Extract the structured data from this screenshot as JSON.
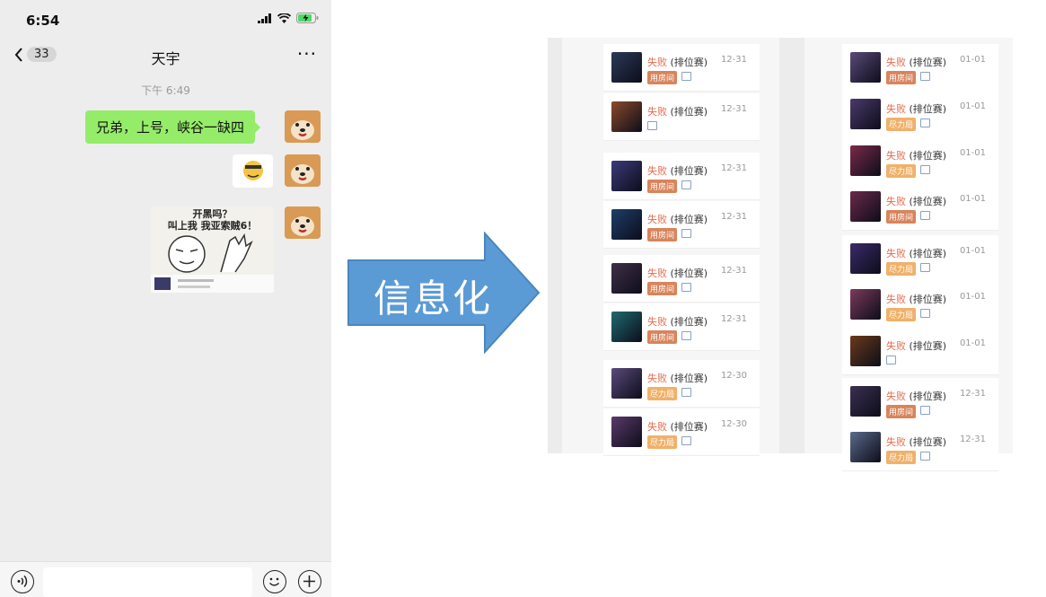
{
  "phone": {
    "status_time": "6:54",
    "back_badge": "33",
    "title": "天宇",
    "more": "···",
    "chat_time": "下午 6:49",
    "message_text": "兄弟，上号，峡谷一缺四",
    "meme_line1": "开黑吗？",
    "meme_line2": "叫上我 我亚索贼6！"
  },
  "arrow_label": "信息化",
  "colors": {
    "bubble": "#95ec69",
    "arrow": "#5b9bd5",
    "loss": "#e36c4e",
    "tag_a": "#d8845c",
    "tag_b": "#f0b169"
  },
  "matches_left": [
    {
      "result": "失败",
      "mode": "(排位赛)",
      "date": "12-31",
      "tag": "用房间",
      "tag_style": "a",
      "champ": "#2b3a58"
    },
    {
      "result": "失败",
      "mode": "(排位赛)",
      "date": "12-31",
      "tag": "",
      "tag_style": "a",
      "champ": "#8a4a2a"
    },
    {
      "result": "失败",
      "mode": "(排位赛)",
      "date": "12-31",
      "tag": "用房间",
      "tag_style": "a",
      "champ": "#3b3a7a"
    },
    {
      "result": "失败",
      "mode": "(排位赛)",
      "date": "12-31",
      "tag": "用房间",
      "tag_style": "a",
      "champ": "#1e3e6a"
    },
    {
      "result": "失败",
      "mode": "(排位赛)",
      "date": "12-31",
      "tag": "用房间",
      "tag_style": "a",
      "champ": "#403048"
    },
    {
      "result": "失败",
      "mode": "(排位赛)",
      "date": "12-31",
      "tag": "用房间",
      "tag_style": "a",
      "champ": "#1f6a70"
    },
    {
      "result": "失败",
      "mode": "(排位赛)",
      "date": "12-30",
      "tag": "尽力局",
      "tag_style": "b",
      "champ": "#5a4a7a"
    },
    {
      "result": "失败",
      "mode": "(排位赛)",
      "date": "12-30",
      "tag": "尽力局",
      "tag_style": "b",
      "champ": "#5a3a6a"
    }
  ],
  "matches_right": [
    {
      "result": "失败",
      "mode": "(排位赛)",
      "date": "01-01",
      "tag": "用房间",
      "tag_style": "a",
      "champ": "#5a4a7a"
    },
    {
      "result": "失败",
      "mode": "(排位赛)",
      "date": "01-01",
      "tag": "尽力局",
      "tag_style": "b",
      "champ": "#4a3a6a"
    },
    {
      "result": "失败",
      "mode": "(排位赛)",
      "date": "01-01",
      "tag": "尽力局",
      "tag_style": "b",
      "champ": "#7a2a4a"
    },
    {
      "result": "失败",
      "mode": "(排位赛)",
      "date": "01-01",
      "tag": "用房间",
      "tag_style": "a",
      "champ": "#6a2a4a"
    },
    {
      "result": "失败",
      "mode": "(排位赛)",
      "date": "01-01",
      "tag": "尽力局",
      "tag_style": "b",
      "champ": "#3a2a6a"
    },
    {
      "result": "失败",
      "mode": "(排位赛)",
      "date": "01-01",
      "tag": "尽力局",
      "tag_style": "b",
      "champ": "#7a3a5a"
    },
    {
      "result": "失败",
      "mode": "(排位赛)",
      "date": "01-01",
      "tag": "",
      "tag_style": "a",
      "champ": "#6a3a1a"
    },
    {
      "result": "失败",
      "mode": "(排位赛)",
      "date": "12-31",
      "tag": "用房间",
      "tag_style": "a",
      "champ": "#3a3050"
    },
    {
      "result": "失败",
      "mode": "(排位赛)",
      "date": "12-31",
      "tag": "尽力局",
      "tag_style": "b",
      "champ": "#5a6a8a"
    }
  ]
}
